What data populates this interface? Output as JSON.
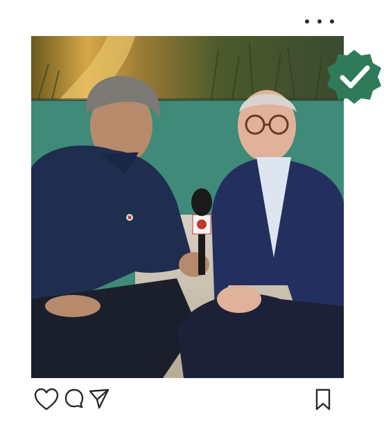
{
  "post": {
    "menu_icon": "more-horizontal-icon",
    "photo_description": "two-men-interview-microphone",
    "verified_icon": "verified-check-badge-icon",
    "colors": {
      "wall": "#3f8a78",
      "badge": "#2f7b59",
      "icon_stroke": "#2a2a2a"
    }
  },
  "actions": {
    "like_icon": "heart-icon",
    "comment_icon": "comment-icon",
    "share_icon": "send-icon",
    "save_icon": "bookmark-icon"
  }
}
